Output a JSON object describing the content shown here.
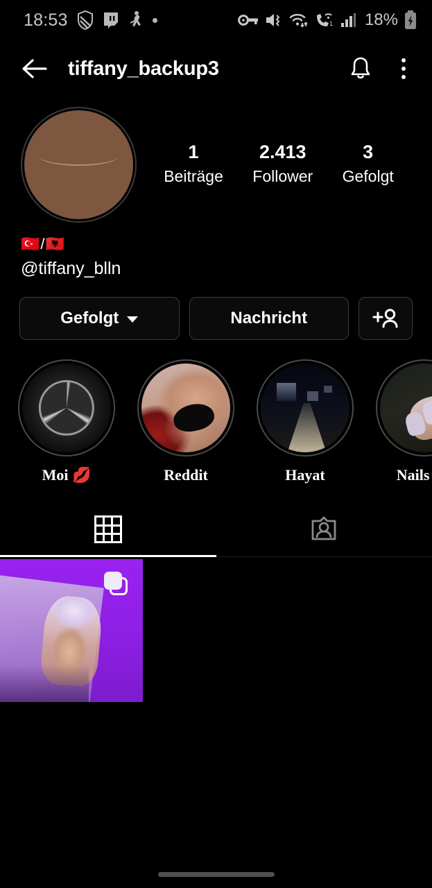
{
  "status_bar": {
    "time": "18:53",
    "left_icons": [
      "shield-icon",
      "twitch-icon",
      "person-dance-icon",
      "dot-icon"
    ],
    "right_icons": [
      "vpn-key-icon",
      "volume-mute-icon",
      "wifi-icon",
      "wifi-calling-icon",
      "signal-bars-icon"
    ],
    "battery_percent": "18%",
    "battery_state": "charging"
  },
  "header": {
    "back_icon": "arrow-left-icon",
    "title": "tiffany_backup3",
    "bell_icon": "bell-icon",
    "menu_icon": "more-vertical-icon"
  },
  "profile": {
    "avatar_alt": "profile-photo",
    "stats": [
      {
        "value": "1",
        "label": "Beiträge"
      },
      {
        "value": "2.413",
        "label": "Follower"
      },
      {
        "value": "3",
        "label": "Gefolgt"
      }
    ],
    "bio_flags": "🇹🇷/🇦🇱",
    "bio_handle": "@tiffany_blln"
  },
  "actions": {
    "follow_label": "Gefolgt",
    "message_label": "Nachricht",
    "add_person_icon": "person-add-icon"
  },
  "highlights": [
    {
      "label": "Moi 💋",
      "thumb": "thumb-car"
    },
    {
      "label": "Reddit",
      "thumb": "thumb-butt"
    },
    {
      "label": "Hayat",
      "thumb": "thumb-road"
    },
    {
      "label": "Nails 💅",
      "thumb": "thumb-nails"
    }
  ],
  "tabs": [
    {
      "name": "grid-tab",
      "icon": "grid-icon",
      "active": true
    },
    {
      "name": "tagged-tab",
      "icon": "tagged-person-icon",
      "active": false
    }
  ],
  "posts": [
    {
      "type": "carousel",
      "overlay_icon": "carousel-icon",
      "accent": "#9a22ef"
    }
  ],
  "colors": {
    "background": "#000000",
    "text": "#ffffff",
    "muted": "#c8c8c8",
    "border": "#3c3c3c",
    "post_accent": "#9a22ef"
  },
  "nav": {
    "gesture_bar": "gesture-bar"
  }
}
